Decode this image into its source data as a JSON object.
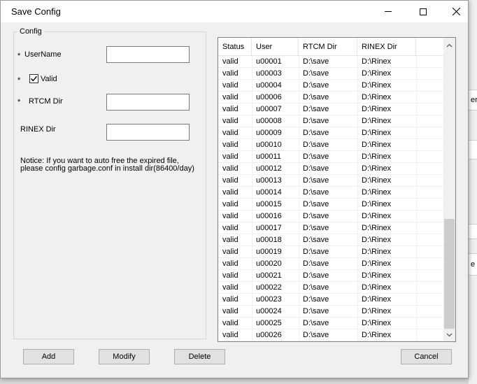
{
  "window": {
    "title": "Save Config"
  },
  "titlebar": {
    "minimize": "minimize-icon",
    "maximize": "maximize-icon",
    "close": "close-icon"
  },
  "form": {
    "group_label": "Config",
    "required_mark": "*",
    "username_label": "UserName",
    "username_value": "",
    "valid_label": "Valid",
    "valid_checked": true,
    "rtcm_label": "RTCM Dir",
    "rtcm_value": "",
    "rinex_label": "RINEX Dir",
    "rinex_value": "",
    "notice": "Notice: If you want to auto free the expired file, please config garbage.conf in install dir(86400/day)"
  },
  "table": {
    "columns": [
      "Status",
      "User",
      "RTCM Dir",
      "RINEX Dir"
    ],
    "rows": [
      [
        "valid",
        "u00001",
        "D:\\save",
        "D:\\Rinex"
      ],
      [
        "valid",
        "u00003",
        "D:\\save",
        "D:\\Rinex"
      ],
      [
        "valid",
        "u00004",
        "D:\\save",
        "D:\\Rinex"
      ],
      [
        "valid",
        "u00006",
        "D:\\save",
        "D:\\Rinex"
      ],
      [
        "valid",
        "u00007",
        "D:\\save",
        "D:\\Rinex"
      ],
      [
        "valid",
        "u00008",
        "D:\\save",
        "D:\\Rinex"
      ],
      [
        "valid",
        "u00009",
        "D:\\save",
        "D:\\Rinex"
      ],
      [
        "valid",
        "u00010",
        "D:\\save",
        "D:\\Rinex"
      ],
      [
        "valid",
        "u00011",
        "D:\\save",
        "D:\\Rinex"
      ],
      [
        "valid",
        "u00012",
        "D:\\save",
        "D:\\Rinex"
      ],
      [
        "valid",
        "u00013",
        "D:\\save",
        "D:\\Rinex"
      ],
      [
        "valid",
        "u00014",
        "D:\\save",
        "D:\\Rinex"
      ],
      [
        "valid",
        "u00015",
        "D:\\save",
        "D:\\Rinex"
      ],
      [
        "valid",
        "u00016",
        "D:\\save",
        "D:\\Rinex"
      ],
      [
        "valid",
        "u00017",
        "D:\\save",
        "D:\\Rinex"
      ],
      [
        "valid",
        "u00018",
        "D:\\save",
        "D:\\Rinex"
      ],
      [
        "valid",
        "u00019",
        "D:\\save",
        "D:\\Rinex"
      ],
      [
        "valid",
        "u00020",
        "D:\\save",
        "D:\\Rinex"
      ],
      [
        "valid",
        "u00021",
        "D:\\save",
        "D:\\Rinex"
      ],
      [
        "valid",
        "u00022",
        "D:\\save",
        "D:\\Rinex"
      ],
      [
        "valid",
        "u00023",
        "D:\\save",
        "D:\\Rinex"
      ],
      [
        "valid",
        "u00024",
        "D:\\save",
        "D:\\Rinex"
      ],
      [
        "valid",
        "u00025",
        "D:\\save",
        "D:\\Rinex"
      ],
      [
        "valid",
        "u00026",
        "D:\\save",
        "D:\\Rinex"
      ]
    ],
    "scroll_up": "chevron-up-icon",
    "scroll_down": "chevron-down-icon"
  },
  "buttons": {
    "add": "Add",
    "modify": "Modify",
    "delete": "Delete",
    "cancel": "Cancel"
  },
  "background_window": {
    "fragment_1": "er",
    "fragment_2": "e"
  }
}
